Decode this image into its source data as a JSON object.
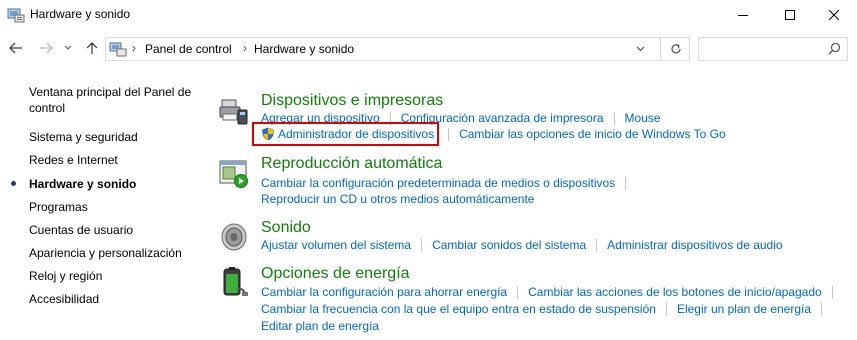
{
  "window": {
    "title": "Hardware y sonido"
  },
  "address": {
    "segments": [
      "Panel de control",
      "Hardware y sonido"
    ],
    "search_placeholder": ""
  },
  "sidebar": {
    "items": [
      {
        "label": "Ventana principal del Panel de control"
      },
      {
        "label": "Sistema y seguridad"
      },
      {
        "label": "Redes e Internet"
      },
      {
        "label": "Hardware y sonido",
        "current": true
      },
      {
        "label": "Programas"
      },
      {
        "label": "Cuentas de usuario"
      },
      {
        "label": "Apariencia y personalización"
      },
      {
        "label": "Reloj y región"
      },
      {
        "label": "Accesibilidad"
      }
    ]
  },
  "categories": [
    {
      "title": "Dispositivos e impresoras",
      "icon": "devices-printers-icon",
      "rows": [
        [
          "Agregar un dispositivo",
          "Configuración avanzada de impresora",
          "Mouse"
        ],
        [
          "Administrador de dispositivos",
          "Cambiar las opciones de inicio de Windows To Go"
        ]
      ]
    },
    {
      "title": "Reproducción automática",
      "icon": "autoplay-icon",
      "rows": [
        [
          "Cambiar la configuración predeterminada de medios o dispositivos"
        ],
        [
          "Reproducir un CD u otros medios automáticamente"
        ]
      ]
    },
    {
      "title": "Sonido",
      "icon": "speaker-icon",
      "rows": [
        [
          "Ajustar volumen del sistema",
          "Cambiar sonidos del sistema",
          "Administrar dispositivos de audio"
        ]
      ]
    },
    {
      "title": "Opciones de energía",
      "icon": "battery-icon",
      "rows": [
        [
          "Cambiar la configuración para ahorrar energía",
          "Cambiar las acciones de los botones de inicio/apagado"
        ],
        [
          "Cambiar la frecuencia con la que el equipo entra en estado de suspensión",
          "Elegir un plan de energía"
        ],
        [
          "Editar plan de energía"
        ]
      ]
    }
  ],
  "colors": {
    "link": "#0066cc",
    "category_title": "#10800a",
    "highlight": "#e00000"
  }
}
